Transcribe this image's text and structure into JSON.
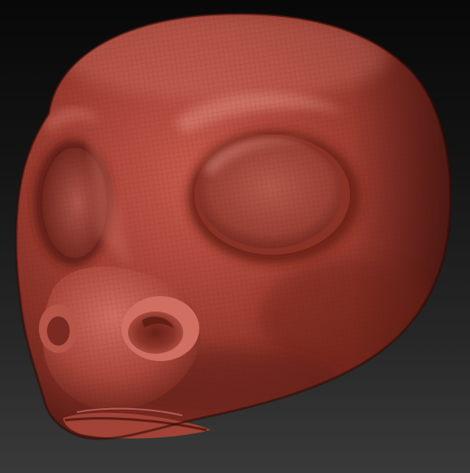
{
  "scene": {
    "subject": "sculpted-creature-head",
    "colors": {
      "background_top": "#080808",
      "background_bottom": "#3a3a3a",
      "material_base": "#9c3b30",
      "material_highlight": "#d98074",
      "material_shadow": "#3e110c",
      "wireframe": "#5a1a14"
    }
  }
}
